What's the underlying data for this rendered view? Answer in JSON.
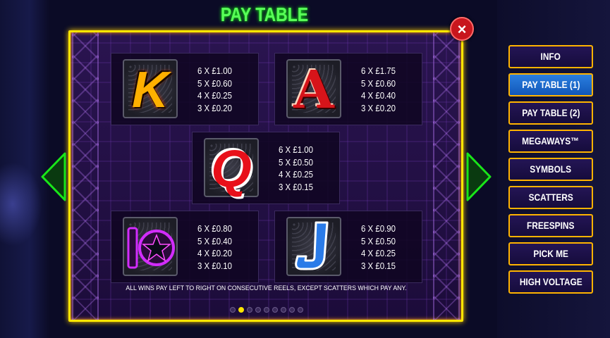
{
  "title": "PAY TABLE",
  "close_label": "×",
  "symbols": [
    {
      "symbol": "K",
      "color": "#ffb000",
      "pays": [
        "6 X £1.00",
        "5 X £0.60",
        "4 X £0.25",
        "3 X £0.20"
      ]
    },
    {
      "symbol": "A",
      "color": "#d7141a",
      "pays": [
        "6 X £1.75",
        "5 X £0.60",
        "4 X £0.40",
        "3 X £0.20"
      ]
    },
    {
      "symbol": "Q",
      "color": "#e8101a",
      "pays": [
        "6 X £1.00",
        "5 X £0.50",
        "4 X £0.25",
        "3 X £0.15"
      ]
    },
    {
      "symbol": "10",
      "color": "#c020ff",
      "pays": [
        "6 X £0.80",
        "5 X £0.40",
        "4 X £0.20",
        "3 X £0.10"
      ]
    },
    {
      "symbol": "J",
      "color": "#2a7be8",
      "pays": [
        "6 X £0.90",
        "5 X £0.50",
        "4 X £0.25",
        "3 X £0.15"
      ]
    }
  ],
  "footer": "ALL WINS PAY LEFT TO RIGHT ON CONSECUTIVE REELS, EXCEPT SCATTERS WHICH PAY ANY.",
  "pagination": {
    "total": 9,
    "active": 2
  },
  "menu": [
    {
      "label": "INFO",
      "active": false
    },
    {
      "label": "PAY TABLE (1)",
      "active": true
    },
    {
      "label": "PAY TABLE (2)",
      "active": false
    },
    {
      "label": "MEGAWAYS™",
      "active": false
    },
    {
      "label": "SYMBOLS",
      "active": false
    },
    {
      "label": "SCATTERS",
      "active": false
    },
    {
      "label": "FREESPINS",
      "active": false
    },
    {
      "label": "PICK ME",
      "active": false
    },
    {
      "label": "HIGH VOLTAGE",
      "active": false
    }
  ],
  "colors": {
    "title": "#58ff58",
    "panel_border": "#ffe600",
    "arrows": "#19e619",
    "menu_border": "#ffb300",
    "menu_active": "#1f6fd0"
  }
}
